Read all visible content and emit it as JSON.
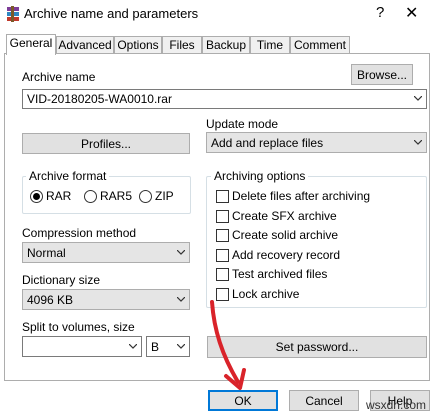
{
  "window": {
    "title": "Archive name and parameters",
    "help_symbol": "?",
    "close_symbol": "✕"
  },
  "tabs": [
    {
      "label": "General",
      "active": true
    },
    {
      "label": "Advanced"
    },
    {
      "label": "Options"
    },
    {
      "label": "Files"
    },
    {
      "label": "Backup"
    },
    {
      "label": "Time"
    },
    {
      "label": "Comment"
    }
  ],
  "archive_name": {
    "label": "Archive name",
    "browse_label": "Browse...",
    "value": "VID-20180205-WA0010.rar"
  },
  "profiles_label": "Profiles...",
  "update_mode": {
    "label": "Update mode",
    "value": "Add and replace files"
  },
  "archive_format": {
    "title": "Archive format",
    "options": [
      {
        "label": "RAR",
        "selected": true
      },
      {
        "label": "RAR5",
        "selected": false
      },
      {
        "label": "ZIP",
        "selected": false
      }
    ]
  },
  "archiving_options": {
    "title": "Archiving options",
    "items": [
      {
        "label": "Delete files after archiving",
        "checked": false
      },
      {
        "label": "Create SFX archive",
        "checked": false
      },
      {
        "label": "Create solid archive",
        "checked": false
      },
      {
        "label": "Add recovery record",
        "checked": false
      },
      {
        "label": "Test archived files",
        "checked": false
      },
      {
        "label": "Lock archive",
        "checked": false
      }
    ]
  },
  "compression_method": {
    "label": "Compression method",
    "value": "Normal"
  },
  "dictionary_size": {
    "label": "Dictionary size",
    "value": "4096 KB"
  },
  "split_volumes": {
    "label": "Split to volumes, size",
    "value": "",
    "unit": "B"
  },
  "set_password_label": "Set password...",
  "footer": {
    "ok_label": "OK",
    "cancel_label": "Cancel",
    "help_label": "Help"
  },
  "watermark": "wsxdn.com",
  "colors": {
    "annotation_arrow": "#d9232a",
    "ok_border": "#0078d7"
  }
}
